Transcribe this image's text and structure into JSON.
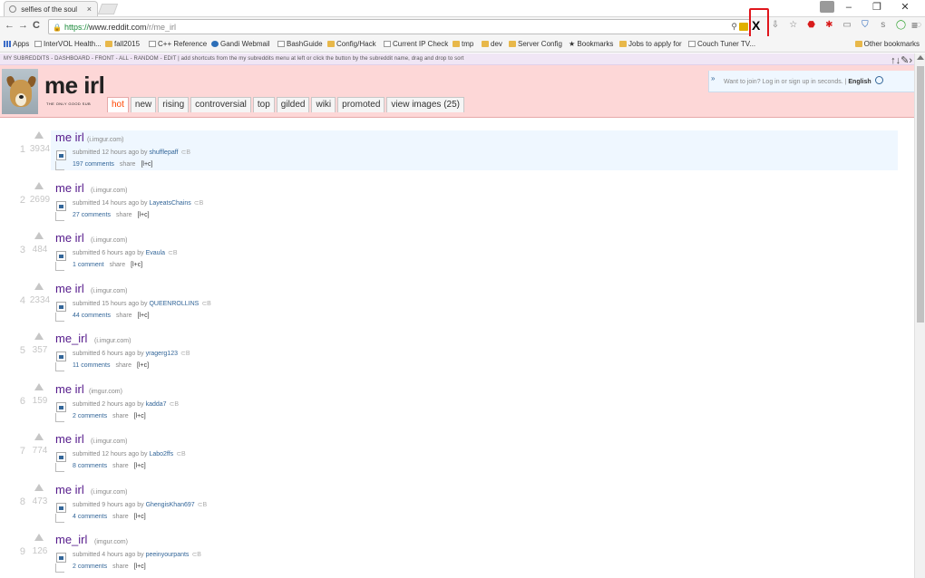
{
  "browser": {
    "tab_title": "selfies of the soul",
    "tab_close": "×",
    "window_controls": [
      "–",
      "❐",
      "✕"
    ],
    "url_scheme": "https://",
    "url_host": "www.reddit.com",
    "url_path": "/r/me_irl",
    "nav": {
      "back": "←",
      "forward": "→",
      "reload": "C"
    },
    "extension_x": "X",
    "menu": "≡",
    "bookmarks": [
      {
        "label": "Apps",
        "icon": "apps-grid"
      },
      {
        "label": "InterVOL Health...",
        "icon": "page"
      },
      {
        "label": "fall2015",
        "icon": "folder"
      },
      {
        "label": "C++ Reference",
        "icon": "page"
      },
      {
        "label": "Gandi Webmail",
        "icon": "globe"
      },
      {
        "label": "BashGuide",
        "icon": "page"
      },
      {
        "label": "Config/Hack",
        "icon": "folder"
      },
      {
        "label": "Current IP Check",
        "icon": "page"
      },
      {
        "label": "tmp",
        "icon": "folder"
      },
      {
        "label": "dev",
        "icon": "folder"
      },
      {
        "label": "Server Config",
        "icon": "folder"
      },
      {
        "label": "Bookmarks",
        "icon": "star"
      },
      {
        "label": "Jobs to apply for",
        "icon": "folder"
      },
      {
        "label": "Couch Tuner TV...",
        "icon": "page"
      }
    ],
    "other_bookmarks": "Other bookmarks"
  },
  "reddit": {
    "srbar": {
      "items": [
        "MY SUBREDDITS",
        "DASHBOARD",
        "FRONT",
        "ALL",
        "RANDOM",
        "EDIT"
      ],
      "hint": "add shortcuts from the my subreddits menu at left or click the button by the subreddit name, drag and drop to sort"
    },
    "subreddit_title": "me irl",
    "subreddit_tagline": "the only good sub",
    "tabs": [
      {
        "label": "hot",
        "selected": true
      },
      {
        "label": "new",
        "selected": false
      },
      {
        "label": "rising",
        "selected": false
      },
      {
        "label": "controversial",
        "selected": false
      },
      {
        "label": "top",
        "selected": false
      },
      {
        "label": "gilded",
        "selected": false
      },
      {
        "label": "wiki",
        "selected": false
      },
      {
        "label": "promoted",
        "selected": false
      },
      {
        "label": "view images (25)",
        "selected": false
      }
    ],
    "login": {
      "arrow": "»",
      "prompt": "Want to join? Log in or sign up in seconds.",
      "separator": "|",
      "language": "English"
    },
    "posts": [
      {
        "rank": "1",
        "score": "3934",
        "title": "me irl",
        "domain": "(i.imgur.com)",
        "submitted": "submitted 12 hours ago by",
        "author": "shufflepaff",
        "comments": "197 comments"
      },
      {
        "rank": "2",
        "score": "2699",
        "title": "me irl",
        "domain": "(i.imgur.com)",
        "submitted": "submitted 14 hours ago by",
        "author": "LayeatsChains",
        "comments": "27 comments"
      },
      {
        "rank": "3",
        "score": "484",
        "title": "me irl",
        "domain": "(i.imgur.com)",
        "submitted": "submitted 6 hours ago by",
        "author": "Evaula",
        "comments": "1 comment"
      },
      {
        "rank": "4",
        "score": "2334",
        "title": "me irl",
        "domain": "(i.imgur.com)",
        "submitted": "submitted 15 hours ago by",
        "author": "QUEENROLLINS",
        "comments": "44 comments"
      },
      {
        "rank": "5",
        "score": "357",
        "title": "me_irl",
        "domain": "(i.imgur.com)",
        "submitted": "submitted 6 hours ago by",
        "author": "yragerg123",
        "comments": "11 comments"
      },
      {
        "rank": "6",
        "score": "159",
        "title": "me irl",
        "domain": "(imgur.com)",
        "submitted": "submitted 2 hours ago by",
        "author": "kadda7",
        "comments": "2 comments"
      },
      {
        "rank": "7",
        "score": "774",
        "title": "me irl",
        "domain": "(i.imgur.com)",
        "submitted": "submitted 12 hours ago by",
        "author": "Labo2ffs",
        "comments": "8 comments"
      },
      {
        "rank": "8",
        "score": "473",
        "title": "me irl",
        "domain": "(i.imgur.com)",
        "submitted": "submitted 9 hours ago by",
        "author": "GhengisKhan697",
        "comments": "4 comments"
      },
      {
        "rank": "9",
        "score": "126",
        "title": "me_irl",
        "domain": "(imgur.com)",
        "submitted": "submitted 4 hours ago by",
        "author": "peeinyourpants",
        "comments": "2 comments"
      }
    ],
    "share_label": "share",
    "lc_label": "[l+c]",
    "rts_label": "⊂B"
  },
  "colors": {
    "header_bg": "#fdd7d7",
    "title_link": "#551a8b",
    "selected_tab": "#ff4500",
    "highlight_bg": "#eff7ff",
    "extension_box": "#e0161c"
  }
}
